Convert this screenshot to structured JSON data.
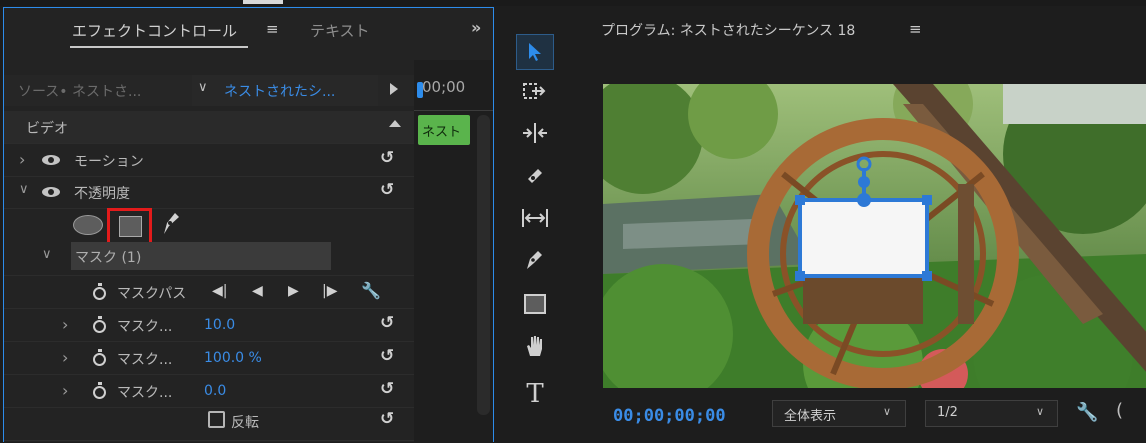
{
  "effect_controls": {
    "tab_title": "エフェクトコントロール",
    "tab_menu": "≡",
    "tab_text": "テキスト",
    "more": "»",
    "source_label": "ソース• ネストさ...",
    "sequence_chev": "∨",
    "sequence_name": "ネストされたシ...",
    "timeline_time": "00;00",
    "clip_label": "ネスト",
    "video_section": "ビデオ",
    "motion": "モーション",
    "opacity": "不透明度",
    "mask_header": "マスク (1)",
    "mask_path": "マスクパス",
    "mask_feather_label": "マスク...",
    "mask_feather_value": "10.0",
    "mask_opacity_label": "マスク...",
    "mask_opacity_value": "100.0 %",
    "mask_expansion_label": "マスク...",
    "mask_expansion_value": "0.0",
    "invert_label": "反転",
    "chevron_right": "›",
    "chevron_down": "∨",
    "reset_glyph": "↺",
    "kf_prev_track": "◀|",
    "kf_prev": "◀",
    "kf_next": "▶",
    "kf_next_track": "|▶",
    "wrench_glyph": "🔧"
  },
  "toolbar": {
    "icons": [
      "selection-tool",
      "track-select-tool",
      "ripple-edit-tool",
      "razor-tool",
      "slip-tool",
      "pen-tool",
      "rectangle-tool",
      "hand-tool",
      "type-tool"
    ],
    "type_glyph": "T"
  },
  "program_monitor": {
    "title": "プログラム: ネストされたシーケンス 18",
    "menu": "≡",
    "timecode": "00;00;00;00",
    "zoom": "全体表示",
    "resolution": "1/2",
    "chev": "∨",
    "wrench": "🔧",
    "paren": "("
  },
  "colors": {
    "accent_blue": "#2d8ceb",
    "value_blue": "#3a8ce6",
    "clip_green": "#5ab44c",
    "highlight_red": "#e31b1b"
  }
}
